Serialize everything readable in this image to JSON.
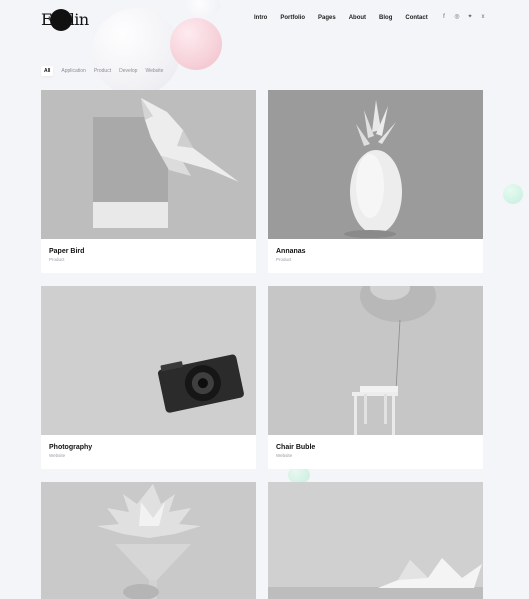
{
  "brand": {
    "logo_text": "Evelin"
  },
  "nav": [
    "Intro",
    "Portfolio",
    "Pages",
    "About",
    "Blog",
    "Contact"
  ],
  "social": [
    {
      "icon": "facebook-icon",
      "glyph": "f"
    },
    {
      "icon": "instagram-icon",
      "glyph": "◎"
    },
    {
      "icon": "twitter-icon",
      "glyph": "✦"
    },
    {
      "icon": "xing-icon",
      "glyph": "x"
    }
  ],
  "filters": [
    "All",
    "Application",
    "Product",
    "Develop",
    "Website"
  ],
  "active_filter": "All",
  "projects": [
    {
      "title": "Paper Bird",
      "category": "Product"
    },
    {
      "title": "Annanas",
      "category": "Product"
    },
    {
      "title": "Photography",
      "category": "Website"
    },
    {
      "title": "Chair Buble",
      "category": "Website"
    },
    {
      "title": "",
      "category": ""
    },
    {
      "title": "",
      "category": ""
    }
  ],
  "colors": {
    "background": "#f4f5f9",
    "text": "#1b1b1b",
    "muted": "#9a9ca4"
  }
}
